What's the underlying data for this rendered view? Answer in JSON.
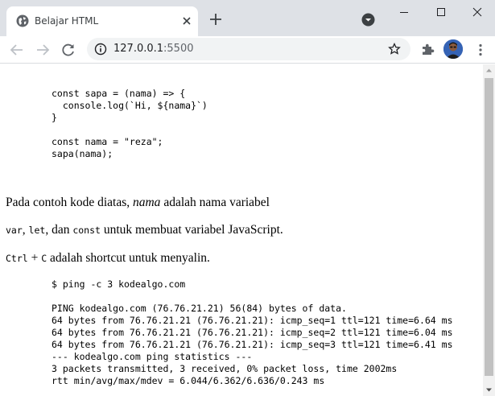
{
  "browser": {
    "tab": {
      "title": "Belajar HTML",
      "favicon": "globe-icon"
    },
    "url": {
      "host": "127.0.0.1",
      "port": ":5500"
    },
    "icons": {
      "back": "arrow-left-icon",
      "forward": "arrow-right-icon",
      "reload": "reload-icon",
      "site_info": "info-icon",
      "bookmark": "star-icon",
      "extensions": "puzzle-icon",
      "menu": "kebab-menu-icon",
      "new_tab": "plus-icon",
      "tab_search": "chevron-down-icon"
    }
  },
  "page": {
    "code_block_1": "const sapa = (nama) => {\n  console.log(`Hi, ${nama}`)\n}\n\nconst nama = \"reza\";\nsapa(nama);",
    "para1": {
      "text_before": "Pada contoh kode diatas, ",
      "em": "nama",
      "text_after": " adalah nama variabel"
    },
    "para2": {
      "code1": "var",
      "sep1": ", ",
      "code2": "let",
      "sep2": ", dan ",
      "code3": "const",
      "text_after": " untuk membuat variabel JavaScript."
    },
    "para3": {
      "kbd1": "Ctrl",
      "plus": " + ",
      "kbd2": "C",
      "text_after": " adalah shortcut untuk menyalin."
    },
    "command": "$ ping -c 3 kodealgo.com",
    "output": "PING kodealgo.com (76.76.21.21) 56(84) bytes of data.\n64 bytes from 76.76.21.21 (76.76.21.21): icmp_seq=1 ttl=121 time=6.64 ms\n64 bytes from 76.76.21.21 (76.76.21.21): icmp_seq=2 ttl=121 time=6.04 ms\n64 bytes from 76.76.21.21 (76.76.21.21): icmp_seq=3 ttl=121 time=6.41 ms\n--- kodealgo.com ping statistics ---\n3 packets transmitted, 3 received, 0% packet loss, time 2002ms\nrtt min/avg/max/mdev = 6.044/6.362/6.636/0.243 ms"
  },
  "colors": {
    "tabstrip": "#dee1e6",
    "omnibox": "#f1f3f4",
    "icon": "#5f6368",
    "scroll_thumb": "#c1c1c1"
  }
}
